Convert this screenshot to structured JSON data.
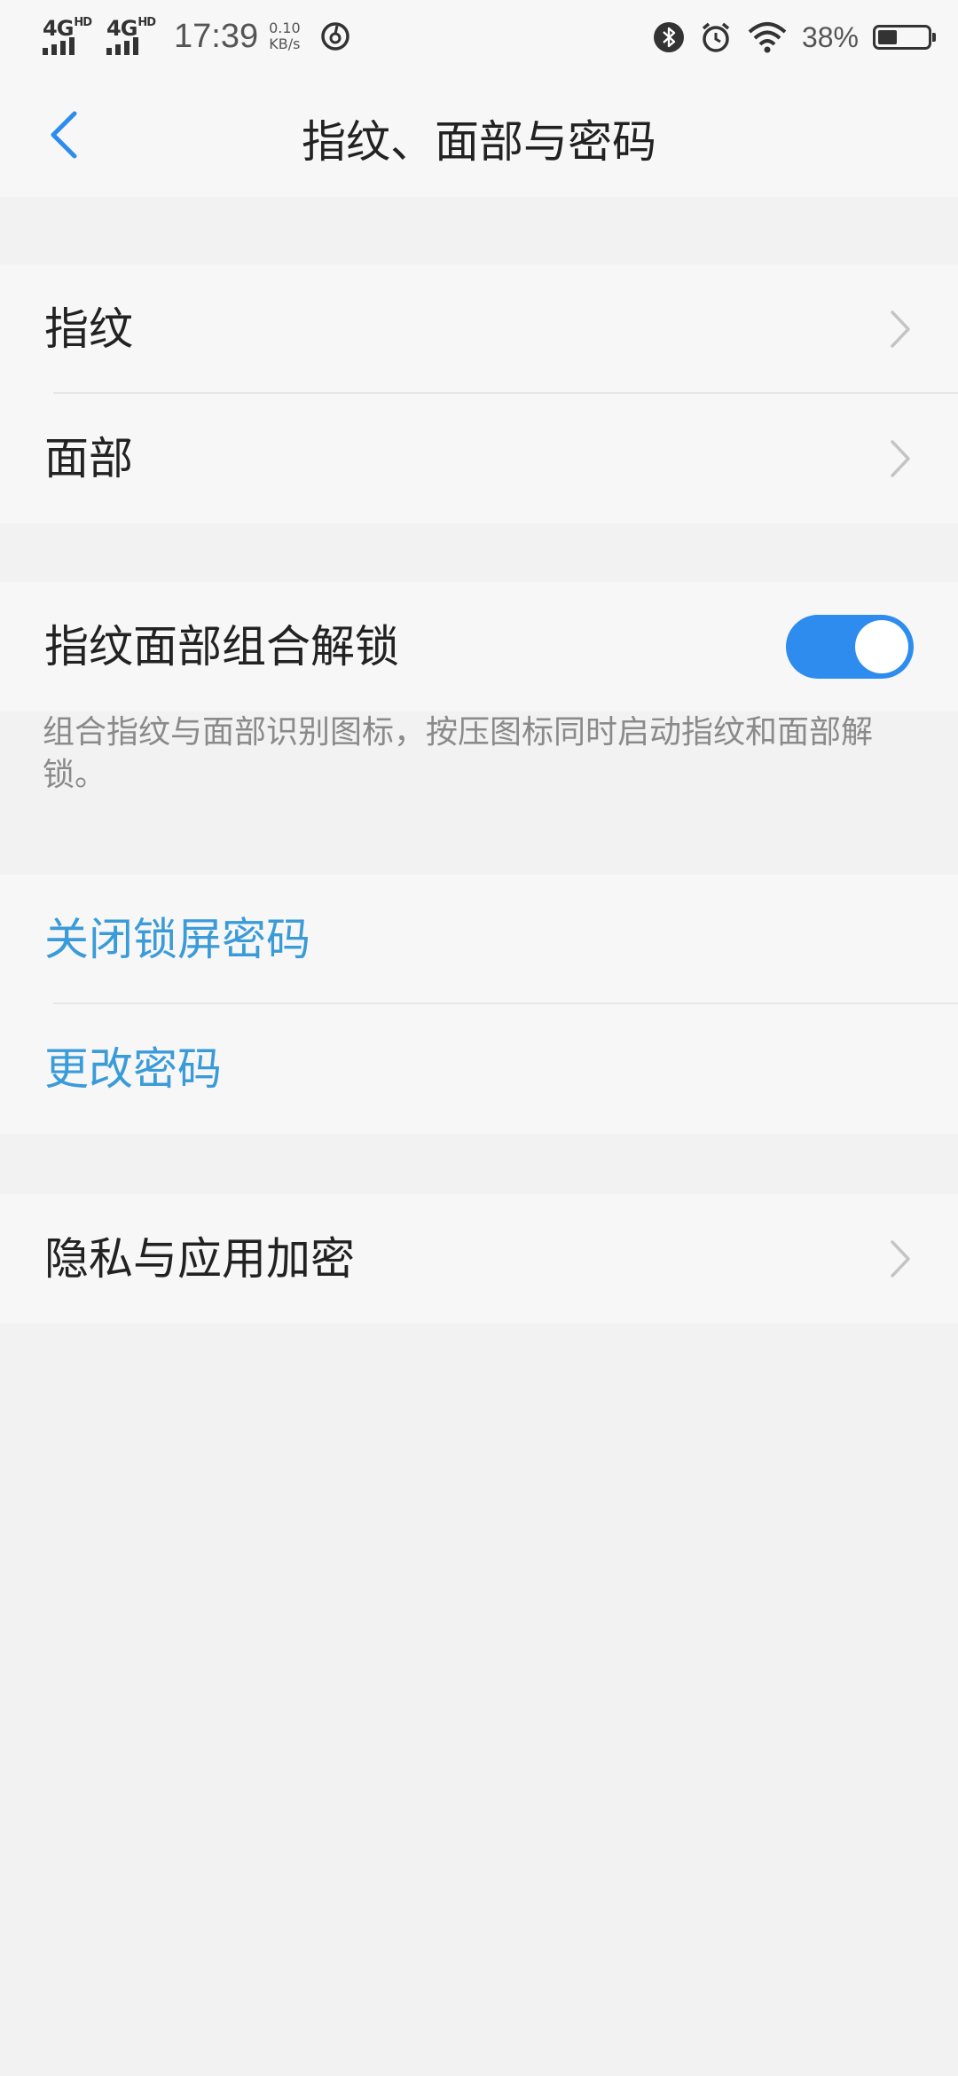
{
  "status_bar": {
    "network_1": "4G",
    "network_1_sup": "HD",
    "network_2": "4G",
    "network_2_sup": "HD",
    "time": "17:39",
    "speed_value": "0.10",
    "speed_unit": "KB/s",
    "battery_text": "38%",
    "battery_level": 0.38,
    "icons": [
      "netease-music-icon",
      "bluetooth-icon",
      "alarm-icon",
      "wifi-icon",
      "battery-icon"
    ]
  },
  "header": {
    "title": "指纹、面部与密码",
    "back_icon": "chevron-left-icon"
  },
  "sections": {
    "biometrics": {
      "fingerprint": "指纹",
      "face": "面部"
    },
    "combo": {
      "label": "指纹面部组合解锁",
      "enabled": true,
      "description": "组合指纹与面部识别图标，按压图标同时启动指纹和面部解锁。"
    },
    "password": {
      "disable": "关闭锁屏密码",
      "change": "更改密码"
    },
    "privacy": {
      "label": "隐私与应用加密"
    }
  },
  "colors": {
    "accent": "#2d8cee",
    "link": "#3a9bd9",
    "background": "#f2f2f2",
    "card": "#f7f7f7"
  }
}
